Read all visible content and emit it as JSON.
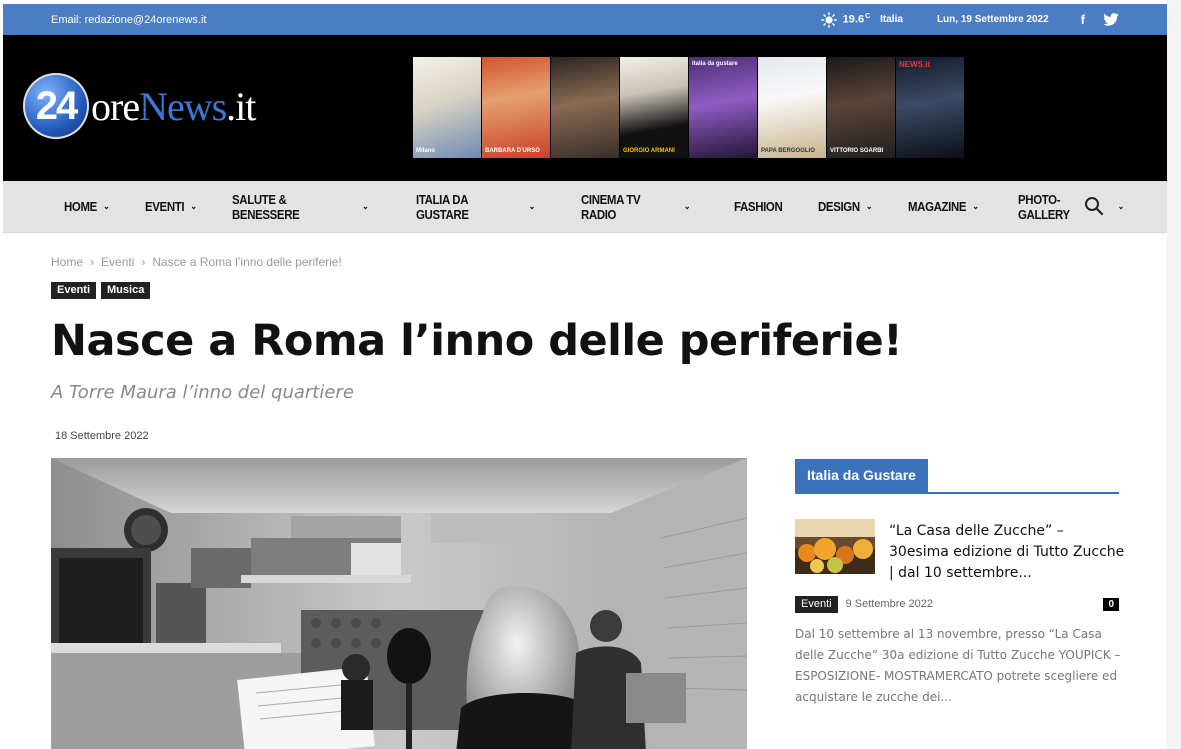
{
  "topbar": {
    "email": "Email: redazione@24orenews.it",
    "weather_icon": "sun-icon",
    "temperature": "19.6",
    "unit": "C",
    "city": "Italia",
    "date": "Lun, 19 Settembre 2022",
    "social": [
      "facebook-icon",
      "twitter-icon"
    ]
  },
  "logo": {
    "number": "24",
    "text_a": "ore",
    "text_b": "News",
    "text_c": ".it"
  },
  "banner": {
    "covers": [
      {
        "caption": "Milano"
      },
      {
        "caption": "BARBARA D'URSO"
      },
      {
        "caption": ""
      },
      {
        "caption": "GIORGIO ARMANI"
      },
      {
        "caption": "italia da gustare"
      },
      {
        "caption": "PAPA BERGOGLIO"
      },
      {
        "caption": "VITTORIO SGARBI"
      },
      {
        "caption": "NEWS.it"
      }
    ]
  },
  "nav": {
    "items": [
      {
        "label": "HOME",
        "dropdown": true
      },
      {
        "label": "EVENTI",
        "dropdown": true
      },
      {
        "label": "SALUTE & BENESSERE",
        "dropdown": true
      },
      {
        "label": "ITALIA DA GUSTARE",
        "dropdown": true
      },
      {
        "label": "CINEMA TV RADIO",
        "dropdown": true
      },
      {
        "label": "FASHION",
        "dropdown": false
      },
      {
        "label": "DESIGN",
        "dropdown": true
      },
      {
        "label": "MAGAZINE",
        "dropdown": true
      },
      {
        "label": "PHOTO-GALLERY",
        "dropdown": true
      }
    ],
    "search_icon": "search-icon"
  },
  "breadcrumb": {
    "home": "Home",
    "section": "Eventi",
    "current": "Nasce a Roma l’inno delle periferie!",
    "separator": "›"
  },
  "article": {
    "tags": [
      "Eventi",
      "Musica"
    ],
    "title": "Nasce a Roma l’inno delle periferie!",
    "subtitle": "A Torre Maura l’inno del quartiere",
    "date": "18 Settembre 2022"
  },
  "sidebar": {
    "heading": "Italia da Gustare",
    "post": {
      "title": "“La Casa delle Zucche” – 30esima edizione di Tutto Zucche | dal 10 settembre...",
      "tag": "Eventi",
      "date": "9 Settembre 2022",
      "comments": "0",
      "excerpt": "Dal 10 settembre al 13 novembre, presso “La Casa delle Zucche” 30a edizione di Tutto Zucche YOUPICK – ESPOSIZIONE- MOSTRAMERCATO potrete scegliere ed acquistare le  zucche dei..."
    }
  },
  "colors": {
    "topbar": "#4a7dc4",
    "accent": "#3b72b9",
    "header": "#000000",
    "nav": "#e3e3e3"
  }
}
